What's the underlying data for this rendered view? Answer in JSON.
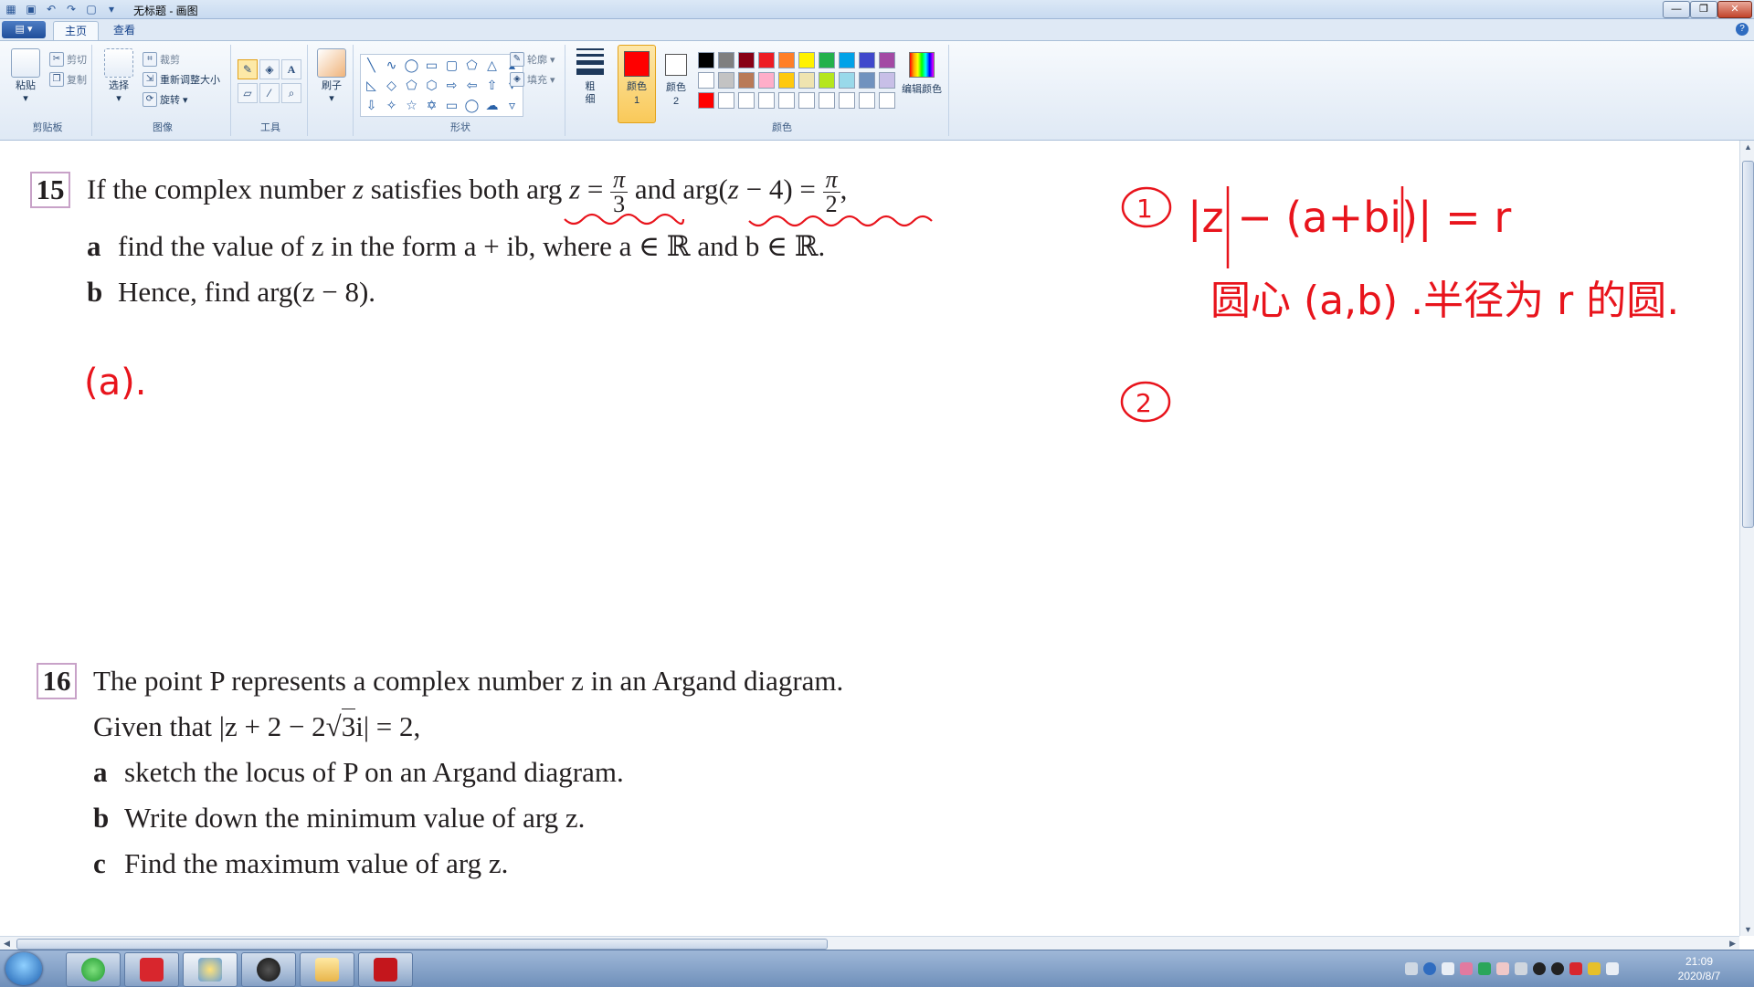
{
  "window": {
    "title": "无标题 - 画图",
    "controls": {
      "min": "—",
      "max": "❐",
      "close": "✕"
    }
  },
  "tabs": {
    "home": "主页",
    "view": "查看"
  },
  "ribbon": {
    "clipboard": {
      "paste": "粘贴",
      "cut": "剪切",
      "copy": "复制",
      "label": "剪贴板"
    },
    "image": {
      "select": "选择",
      "crop": "裁剪",
      "resize": "重新调整大小",
      "rotate": "旋转",
      "label": "图像"
    },
    "tools": {
      "label": "工具"
    },
    "brush": {
      "label": "刷子"
    },
    "shapes": {
      "outline": "轮廓",
      "fill": "填充",
      "label": "形状"
    },
    "size": {
      "label": "粗细"
    },
    "colors": {
      "color1": "颜色 1",
      "color2": "颜色 2",
      "edit": "编辑颜色",
      "label": "颜色",
      "color1_value": "#ff0000",
      "color2_value": "#ffffff",
      "palette": [
        "#000000",
        "#7f7f7f",
        "#880015",
        "#ed1c24",
        "#ff7f27",
        "#fff200",
        "#22b14c",
        "#00a2e8",
        "#3f48cc",
        "#a349a4",
        "#ffffff",
        "#c3c3c3",
        "#b97a57",
        "#ffaec9",
        "#ffc90e",
        "#efe4b0",
        "#b5e61d",
        "#99d9ea",
        "#7092be",
        "#c8bfe7",
        "#ff0000",
        "#ffffff",
        "#ffffff",
        "#ffffff",
        "#ffffff",
        "#ffffff",
        "#ffffff",
        "#ffffff",
        "#ffffff",
        "#ffffff"
      ]
    }
  },
  "canvas": {
    "q15": {
      "number": "15",
      "stem_start": "If the complex number ",
      "stem_z": "z",
      "stem_mid": " satisfies both arg ",
      "stem_z2": "z",
      "eq": " = ",
      "pi": "π",
      "den3": "3",
      "and": " and arg(",
      "z3": "z",
      "minus4": " − 4) = ",
      "den2": "2",
      "comma": ",",
      "a_label": "a",
      "a_text": "find the value of z in the form a + ib, where a ∈ ℝ and b ∈ ℝ.",
      "b_label": "b",
      "b_text": "Hence, find arg(z − 8)."
    },
    "q16": {
      "number": "16",
      "line1": "The point P represents a complex number z in an Argand diagram.",
      "line2_start": "Given that |z + 2 − 2√",
      "line2_sqrt": "3",
      "line2_end": "i| = 2,",
      "a_label": "a",
      "a_text": "sketch the locus of P on an Argand diagram.",
      "b_label": "b",
      "b_text": "Write down the minimum value of arg z.",
      "c_label": "c",
      "c_text": "Find the maximum value of arg z."
    },
    "handwriting": {
      "part_a": "(a).",
      "note1_num": "1",
      "note1_eq": "|z − (a+bi)| = r",
      "note1_desc": "圆心 (a,b) .半径为 r 的圆.",
      "note2_num": "2",
      "ink_color": "#e8141c"
    }
  },
  "taskbar": {
    "clock_time": "21:09",
    "clock_date": "2020/8/7"
  }
}
